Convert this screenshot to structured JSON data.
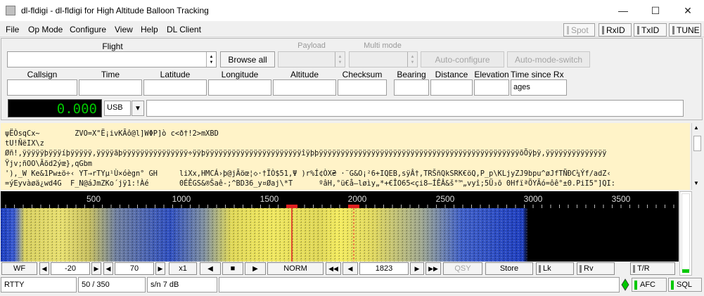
{
  "window": {
    "title": "dl-fldigi - dl-fldigi for High Altitude Balloon Tracking",
    "minimize": "—",
    "maximize": "☐",
    "close": "✕"
  },
  "menu": [
    "File",
    "Op Mode",
    "Configure",
    "View",
    "Help",
    "DL Client"
  ],
  "toggles": {
    "spot": "Spot",
    "rxid": "RxID",
    "txid": "TxID",
    "tune": "TUNE"
  },
  "flight": {
    "flight_label": "Flight",
    "browse_all": "Browse all",
    "payload_label": "Payload",
    "multimode_label": "Multi mode",
    "auto_configure": "Auto-configure",
    "auto_mode_switch": "Auto-mode-switch"
  },
  "fields": {
    "labels": [
      "Callsign",
      "Time",
      "Latitude",
      "Longitude",
      "Altitude",
      "Checksum",
      "Bearing",
      "Distance",
      "Elevation",
      "Time since Rx"
    ],
    "time_since_rx_value": "ages"
  },
  "freq": {
    "display": "0.000",
    "mode": "USB",
    "arrow": "▼"
  },
  "rx_text": [
    "ψËÒsqCx~        ZVO=X\"Ë¡ivKÃô@l]WΦP]ò c<ð†!2>mXBD",
    "tU!ÑëIX\\z",
    "Øñ!,ÿÿÿÿÿþÿÿÿíþÿÿÿÿÿ,ÿÿÿÿãþÿÿÿÿÿÿÿÿÿÿÿÿÿÿÿ÷ÿÿþÿÿÿÿÿÿÿÿÿÿÿÿÿÿÿÿÿÿÿÿÿÿîÿþþÿÿÿÿÿÿÿÿÿÿÿÿÿÿÿÿÿÿÿÿÿÿÿÿÿÿÿÿÿÿÿÿÿÿÿÿÿÿÿÿÿÿÿÿÿÿõÕÿþÿ,ÿÿÿÿÿÿÿÿÿÿÿÿÿÿ",
    "Ÿjv;ñOO\\Ãõd2ýœ},qGbm",
    "'),_W Ke&1Pw±ö÷‹ YT→rTYµ¹Ù×óègn° GH     liXx,HMCÁ›þ@jÃöœ¦◇·†ÏÒ$51,Ψ )r%Í¢ÒX₴ ·¨G&O¡²6+IQEB,sÿÂ†,TRŠñQkSRK€öQ,P_p\\KLjyZJ9bpu^øJfTÑÐC¼Ýf/adZ‹",
    "=ýEyvàøä¿wd4G  F_N@áJmZKo´jÿ1:!Àé       0ÉÊGS&®Šaê-;^BD36_y¤Øaj\\*T      ºâH,°ü€å—løìy„*+€ÎO65<çi8–ÍÊÂ&š°™„vyî;5Ü₃ō 0HfïªÖYÃó=ôê°±0.PiI5\"]QI:"
  ],
  "scale": {
    "ticks": [
      "500",
      "1000",
      "1500",
      "2000",
      "2500",
      "3000",
      "3500"
    ]
  },
  "controls": {
    "wf": "WF",
    "level1": "-20",
    "level2": "70",
    "zoom": "x1",
    "stop": "■",
    "mode": "NORM",
    "freq": "1823",
    "qsy": "QSY",
    "store": "Store",
    "lk": "Lk",
    "rv": "Rv",
    "tr": "T/R"
  },
  "status": {
    "mode": "RTTY",
    "counter": "50 / 350",
    "sn": "s/n   7 dB",
    "afc": "AFC",
    "sql": "SQL"
  },
  "colors": {
    "accent": "#00c800",
    "rx_bg": "#fff3c8",
    "marker": "#e02020"
  }
}
